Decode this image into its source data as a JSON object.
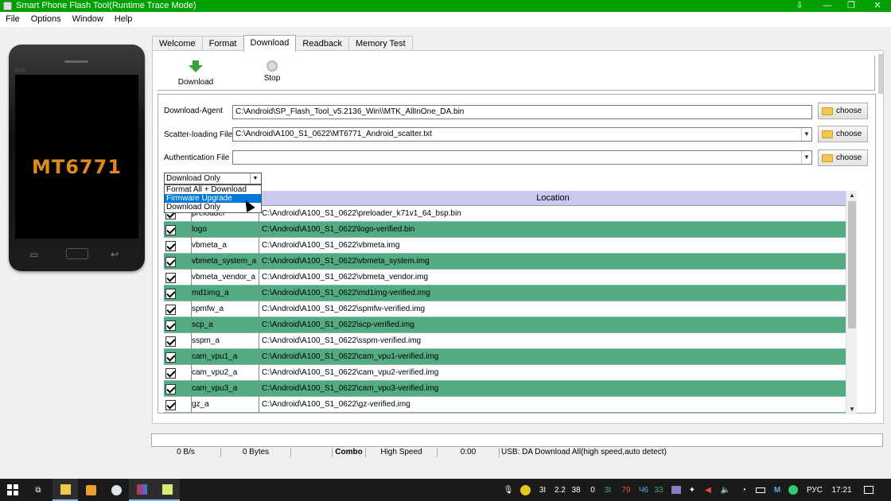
{
  "window": {
    "title": "Smart Phone Flash Tool(Runtime Trace Mode)",
    "controls": {
      "pin": "⇩",
      "minimize": "—",
      "restore": "❐",
      "close": "✕"
    }
  },
  "menu": [
    "File",
    "Options",
    "Window",
    "Help"
  ],
  "phone": {
    "brand": "BM",
    "chip": "MT6771"
  },
  "tabs": [
    "Welcome",
    "Format",
    "Download",
    "Readback",
    "Memory Test"
  ],
  "active_tab": "Download",
  "toolbar": {
    "download_label": "Download",
    "stop_label": "Stop"
  },
  "form": {
    "download_agent_label": "Download-Agent",
    "download_agent_value": "C:\\Android\\SP_Flash_Tool_v5.2136_Win\\\\MTK_AllInOne_DA.bin",
    "scatter_label": "Scatter-loading File",
    "scatter_value": "C:\\Android\\A100_S1_0622\\MT6771_Android_scatter.txt",
    "auth_label": "Authentication File",
    "auth_value": "",
    "choose_label": "choose"
  },
  "mode": {
    "selected": "Download Only",
    "options": [
      "Format All + Download",
      "Firmware Upgrade",
      "Download Only"
    ],
    "highlighted": "Firmware Upgrade"
  },
  "grid": {
    "header": "Location",
    "rows": [
      {
        "name": "preloader",
        "location": "C:\\Android\\A100_S1_0622\\preloader_k71v1_64_bsp.bin",
        "checked": true
      },
      {
        "name": "logo",
        "location": "C:\\Android\\A100_S1_0622\\logo-verified.bin",
        "checked": true
      },
      {
        "name": "vbmeta_a",
        "location": "C:\\Android\\A100_S1_0622\\vbmeta.img",
        "checked": true
      },
      {
        "name": "vbmeta_system_a",
        "location": "C:\\Android\\A100_S1_0622\\vbmeta_system.img",
        "checked": true
      },
      {
        "name": "vbmeta_vendor_a",
        "location": "C:\\Android\\A100_S1_0622\\vbmeta_vendor.img",
        "checked": true
      },
      {
        "name": "md1img_a",
        "location": "C:\\Android\\A100_S1_0622\\md1img-verified.img",
        "checked": true
      },
      {
        "name": "spmfw_a",
        "location": "C:\\Android\\A100_S1_0622\\spmfw-verified.img",
        "checked": true
      },
      {
        "name": "scp_a",
        "location": "C:\\Android\\A100_S1_0622\\scp-verified.img",
        "checked": true
      },
      {
        "name": "sspm_a",
        "location": "C:\\Android\\A100_S1_0622\\sspm-verified.img",
        "checked": true
      },
      {
        "name": "cam_vpu1_a",
        "location": "C:\\Android\\A100_S1_0622\\cam_vpu1-verified.img",
        "checked": true
      },
      {
        "name": "cam_vpu2_a",
        "location": "C:\\Android\\A100_S1_0622\\cam_vpu2-verified.img",
        "checked": true
      },
      {
        "name": "cam_vpu3_a",
        "location": "C:\\Android\\A100_S1_0622\\cam_vpu3-verified.img",
        "checked": true
      },
      {
        "name": "gz_a",
        "location": "C:\\Android\\A100_S1_0622\\gz-verified.img",
        "checked": true
      }
    ]
  },
  "status": {
    "speed": "0 B/s",
    "bytes": "0 Bytes",
    "blank": "",
    "combo": "Combo",
    "mode": "High Speed",
    "time": "0:00",
    "usb": "USB: DA Download All(high speed,auto detect)"
  },
  "taskbar": {
    "tray": {
      "lang": "РУС",
      "time": "17:21",
      "readouts": [
        "3I",
        "2.2",
        "38",
        "0",
        "3I",
        "79",
        "Ч6",
        "33"
      ]
    }
  },
  "colors": {
    "titlebar": "#00a000",
    "row_alt": "#53ab82",
    "header": "#c8c8f0",
    "chip": "#e08a1e"
  }
}
